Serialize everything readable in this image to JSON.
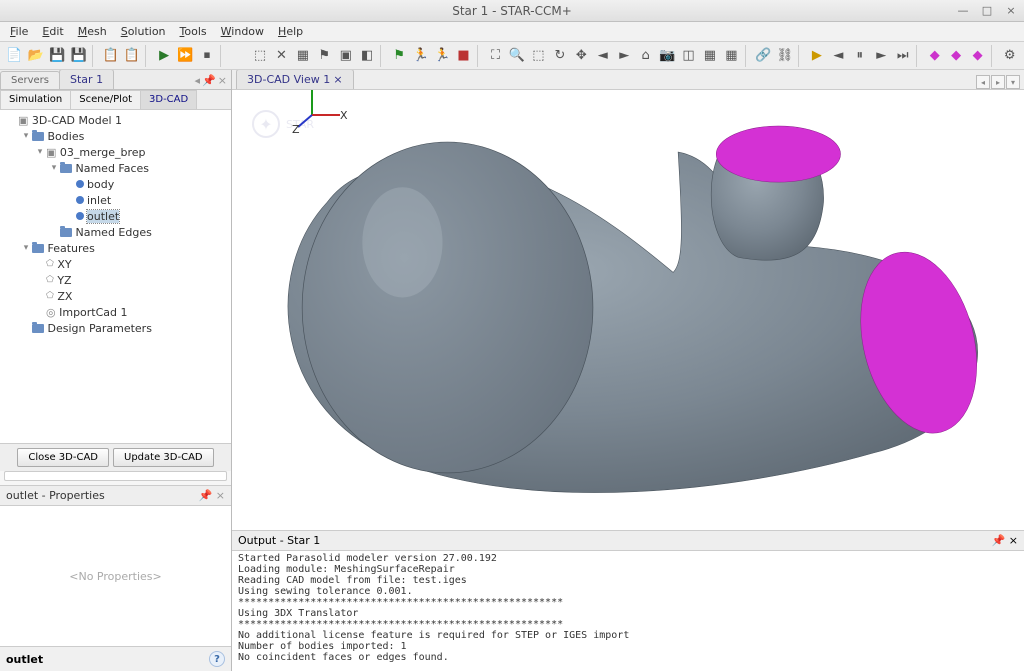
{
  "window": {
    "title": "Star 1 - STAR-CCM+"
  },
  "menu": {
    "file": "File",
    "edit": "Edit",
    "mesh": "Mesh",
    "solution": "Solution",
    "tools": "Tools",
    "window": "Window",
    "help": "Help"
  },
  "left_tabs": {
    "servers": "Servers",
    "star1": "Star 1"
  },
  "sub_tabs": {
    "simulation": "Simulation",
    "sceneplot": "Scene/Plot",
    "cad": "3D-CAD"
  },
  "tree": {
    "root": "3D-CAD Model 1",
    "bodies": "Bodies",
    "merge": "03_merge_brep",
    "named_faces": "Named Faces",
    "body": "body",
    "inlet": "inlet",
    "outlet": "outlet",
    "named_edges": "Named Edges",
    "features": "Features",
    "xy": "XY",
    "yz": "YZ",
    "zx": "ZX",
    "importcad": "ImportCad 1",
    "design_params": "Design Parameters"
  },
  "buttons": {
    "close": "Close 3D-CAD",
    "update": "Update 3D-CAD"
  },
  "props": {
    "title": "outlet - Properties",
    "empty": "<No Properties>"
  },
  "bottom": {
    "field": "outlet"
  },
  "view_tab": {
    "label": "3D-CAD View 1"
  },
  "watermark": "STAR",
  "output": {
    "title": "Output - Star 1",
    "lines": "Started Parasolid modeler version 27.00.192\nLoading module: MeshingSurfaceRepair\nReading CAD model from file: test.iges\nUsing sewing tolerance 0.001.\n******************************************************\nUsing 3DX Translator\n******************************************************\nNo additional license feature is required for STEP or IGES import\nNumber of bodies imported: 1\nNo coincident faces or edges found."
  }
}
